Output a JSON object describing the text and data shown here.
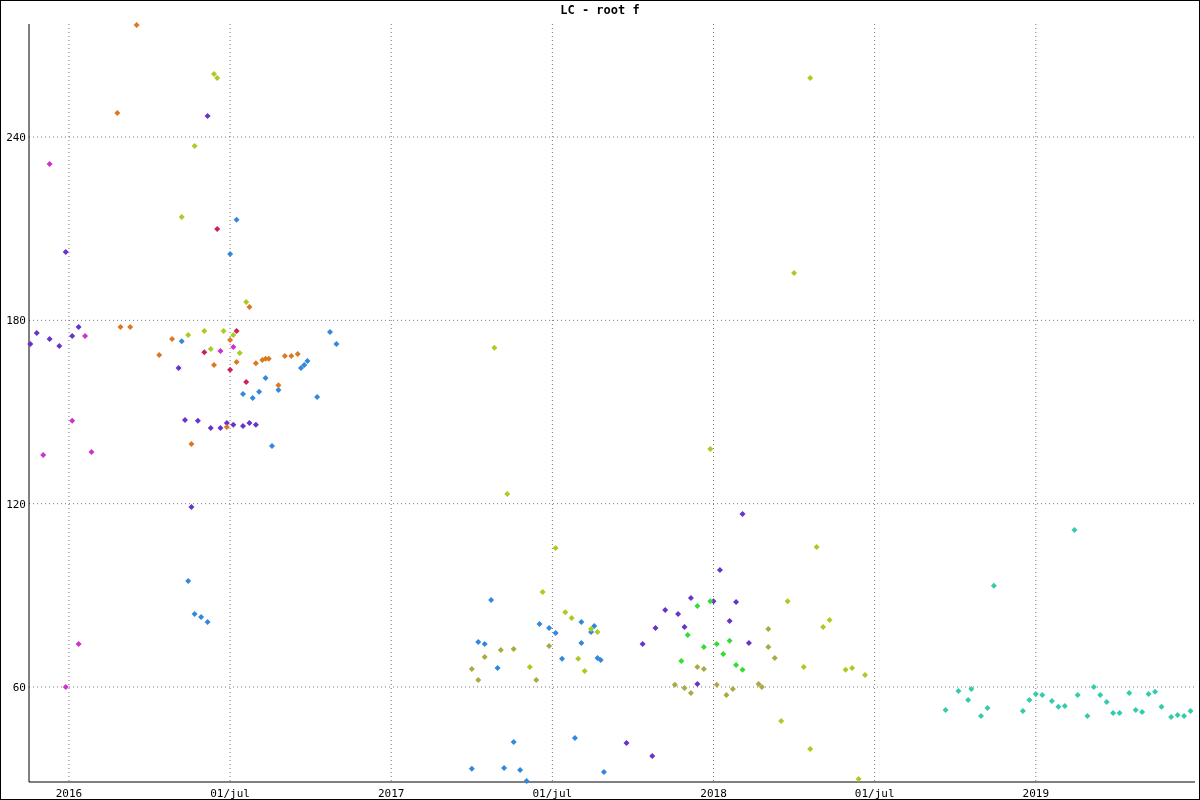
{
  "plot": {
    "chart_data": {
      "type": "scatter",
      "title": "LC - root f",
      "xlim": [
        2015.876,
        2019.494
      ],
      "ylim": [
        28.9,
        277
      ],
      "xticks": [
        {
          "value": 2016,
          "label": "2016"
        },
        {
          "value": 2016.5,
          "label": "01/jul"
        },
        {
          "value": 2017,
          "label": "2017"
        },
        {
          "value": 2017.5,
          "label": "01/jul"
        },
        {
          "value": 2018,
          "label": "2018"
        },
        {
          "value": 2018.5,
          "label": "01/jul"
        },
        {
          "value": 2019,
          "label": "2019"
        }
      ],
      "yticks": [
        60,
        120,
        180,
        240
      ],
      "grid": true,
      "series": [
        {
          "color": "#6633cc",
          "x": [
            2015.88,
            2015.9,
            2015.94,
            2015.97,
            2016.01,
            2016.03,
            2015.99,
            2016.34,
            2016.36,
            2016.4,
            2016.44,
            2016.47,
            2016.49,
            2016.51,
            2016.54,
            2016.56,
            2016.58,
            2016.38,
            2016.43,
            2017.73,
            2017.81,
            2017.78,
            2017.85,
            2017.89,
            2017.93,
            2017.95,
            2018.0,
            2018.02,
            2018.05,
            2018.07,
            2018.09,
            2018.11,
            2017.91,
            2017.82
          ],
          "values": [
            172.3,
            175.9,
            173.9,
            171.6,
            174.9,
            177.8,
            202.4,
            164.4,
            147.4,
            147.1,
            144.8,
            144.8,
            146.4,
            145.8,
            145.4,
            146.4,
            145.8,
            118.9,
            246.9,
            41.7,
            37.4,
            74.1,
            85.2,
            83.9,
            89.1,
            61.0,
            88.1,
            98.3,
            81.6,
            87.8,
            116.6,
            74.4,
            79.6,
            79.3
          ]
        },
        {
          "color": "#3388dd",
          "x": [
            2016.35,
            2016.52,
            2016.5,
            2016.54,
            2016.57,
            2016.59,
            2016.61,
            2016.63,
            2016.65,
            2016.72,
            2016.73,
            2016.74,
            2016.77,
            2016.81,
            2016.83,
            2016.37,
            2016.39,
            2016.41,
            2016.43,
            2017.25,
            2017.31,
            2017.27,
            2017.29,
            2017.33,
            2017.35,
            2017.38,
            2017.4,
            2017.42,
            2017.46,
            2017.49,
            2017.51,
            2017.53,
            2017.57,
            2017.59,
            2017.62,
            2017.63,
            2017.64,
            2017.65,
            2017.66,
            2017.59
          ],
          "values": [
            173.2,
            212.9,
            201.7,
            155.9,
            154.6,
            156.6,
            161.1,
            138.9,
            157.2,
            164.4,
            165.4,
            166.7,
            154.9,
            176.2,
            172.3,
            94.7,
            83.9,
            82.9,
            81.3,
            33.2,
            88.5,
            74.7,
            74.1,
            66.2,
            33.5,
            42.0,
            32.8,
            29.2,
            80.6,
            79.3,
            77.7,
            69.2,
            43.3,
            81.3,
            78.0,
            80.0,
            69.5,
            68.8,
            32.2,
            74.4
          ]
        },
        {
          "color": "#dd7722",
          "x": [
            2016.15,
            2016.16,
            2016.19,
            2016.21,
            2016.28,
            2016.32,
            2016.38,
            2016.45,
            2016.52,
            2016.56,
            2016.58,
            2016.6,
            2016.61,
            2016.62,
            2016.65,
            2016.67,
            2016.69,
            2016.71,
            2016.49,
            2016.5
          ],
          "values": [
            247.9,
            177.8,
            177.8,
            276.7,
            168.7,
            173.9,
            139.5,
            165.4,
            166.4,
            184.4,
            166.0,
            167.0,
            167.4,
            167.4,
            158.8,
            168.3,
            168.3,
            169.0,
            145.1,
            173.6
          ]
        },
        {
          "color": "#aacc22",
          "x": [
            2016.37,
            2016.42,
            2016.44,
            2016.48,
            2016.51,
            2016.53,
            2016.45,
            2016.46,
            2016.39,
            2016.35,
            2016.55,
            2017.32,
            2017.36,
            2017.51,
            2017.47,
            2017.43,
            2017.54,
            2017.56,
            2017.58,
            2017.62,
            2017.64,
            2017.6,
            2018.3,
            2018.25,
            2018.32,
            2017.99,
            2018.23,
            2018.28,
            2018.21,
            2018.3,
            2018.45,
            2018.34,
            2018.36,
            2018.41,
            2018.43,
            2018.47
          ],
          "values": [
            175.2,
            176.5,
            170.6,
            176.5,
            175.2,
            169.3,
            260.6,
            259.3,
            237.1,
            213.8,
            186.0,
            171.0,
            123.2,
            105.5,
            91.1,
            66.5,
            84.5,
            82.6,
            69.2,
            79.0,
            78.0,
            65.2,
            259.3,
            195.5,
            105.8,
            137.9,
            88.1,
            66.5,
            48.9,
            39.7,
            29.9,
            79.6,
            81.9,
            65.6,
            66.2,
            63.9
          ]
        },
        {
          "color": "#cc33cc",
          "x": [
            2016.01,
            2016.03,
            2015.99,
            2016.05,
            2015.92,
            2015.94,
            2016.07,
            2016.51,
            2016.47
          ],
          "values": [
            147.1,
            74.1,
            60.0,
            174.9,
            135.9,
            231.2,
            136.9,
            171.3,
            170.0
          ]
        },
        {
          "color": "#cc2255",
          "x": [
            2016.46,
            2016.42,
            2016.5,
            2016.52,
            2016.55
          ],
          "values": [
            209.9,
            169.6,
            163.8,
            176.5,
            159.8
          ]
        },
        {
          "color": "#aaaa44",
          "x": [
            2017.25,
            2017.27,
            2017.29,
            2017.34,
            2017.38,
            2017.45,
            2017.49,
            2017.88,
            2017.91,
            2017.93,
            2017.95,
            2017.97,
            2018.01,
            2018.04,
            2018.06,
            2018.14,
            2018.15,
            2018.17,
            2018.19,
            2018.17
          ],
          "values": [
            65.9,
            62.3,
            69.8,
            72.1,
            72.4,
            62.3,
            73.4,
            60.7,
            59.7,
            58.0,
            66.5,
            65.9,
            60.7,
            57.4,
            59.3,
            61.0,
            60.0,
            73.1,
            69.5,
            79.0
          ]
        },
        {
          "color": "#33dd33",
          "x": [
            2017.9,
            2017.92,
            2017.95,
            2017.97,
            2017.99,
            2018.01,
            2018.03,
            2018.05,
            2018.07,
            2018.09
          ],
          "values": [
            68.5,
            77.0,
            86.5,
            73.1,
            88.1,
            74.1,
            70.8,
            75.1,
            67.2,
            65.6
          ]
        },
        {
          "color": "#33ccaa",
          "x": [
            2018.72,
            2018.76,
            2018.79,
            2018.8,
            2018.83,
            2018.85,
            2018.87,
            2018.96,
            2018.98,
            2019.0,
            2019.02,
            2019.05,
            2019.07,
            2019.09,
            2019.12,
            2019.13,
            2019.16,
            2019.18,
            2019.2,
            2019.22,
            2019.24,
            2019.26,
            2019.29,
            2019.31,
            2019.33,
            2019.35,
            2019.37,
            2019.39,
            2019.42,
            2019.44,
            2019.46,
            2019.48
          ],
          "values": [
            52.5,
            58.7,
            55.7,
            59.3,
            50.5,
            53.1,
            93.1,
            52.1,
            55.7,
            57.7,
            57.4,
            55.4,
            53.5,
            53.8,
            111.4,
            57.4,
            50.5,
            60.0,
            57.4,
            55.1,
            51.5,
            51.5,
            58.0,
            52.5,
            51.8,
            57.7,
            58.4,
            53.5,
            50.2,
            50.8,
            50.5,
            52.1
          ]
        }
      ]
    }
  }
}
